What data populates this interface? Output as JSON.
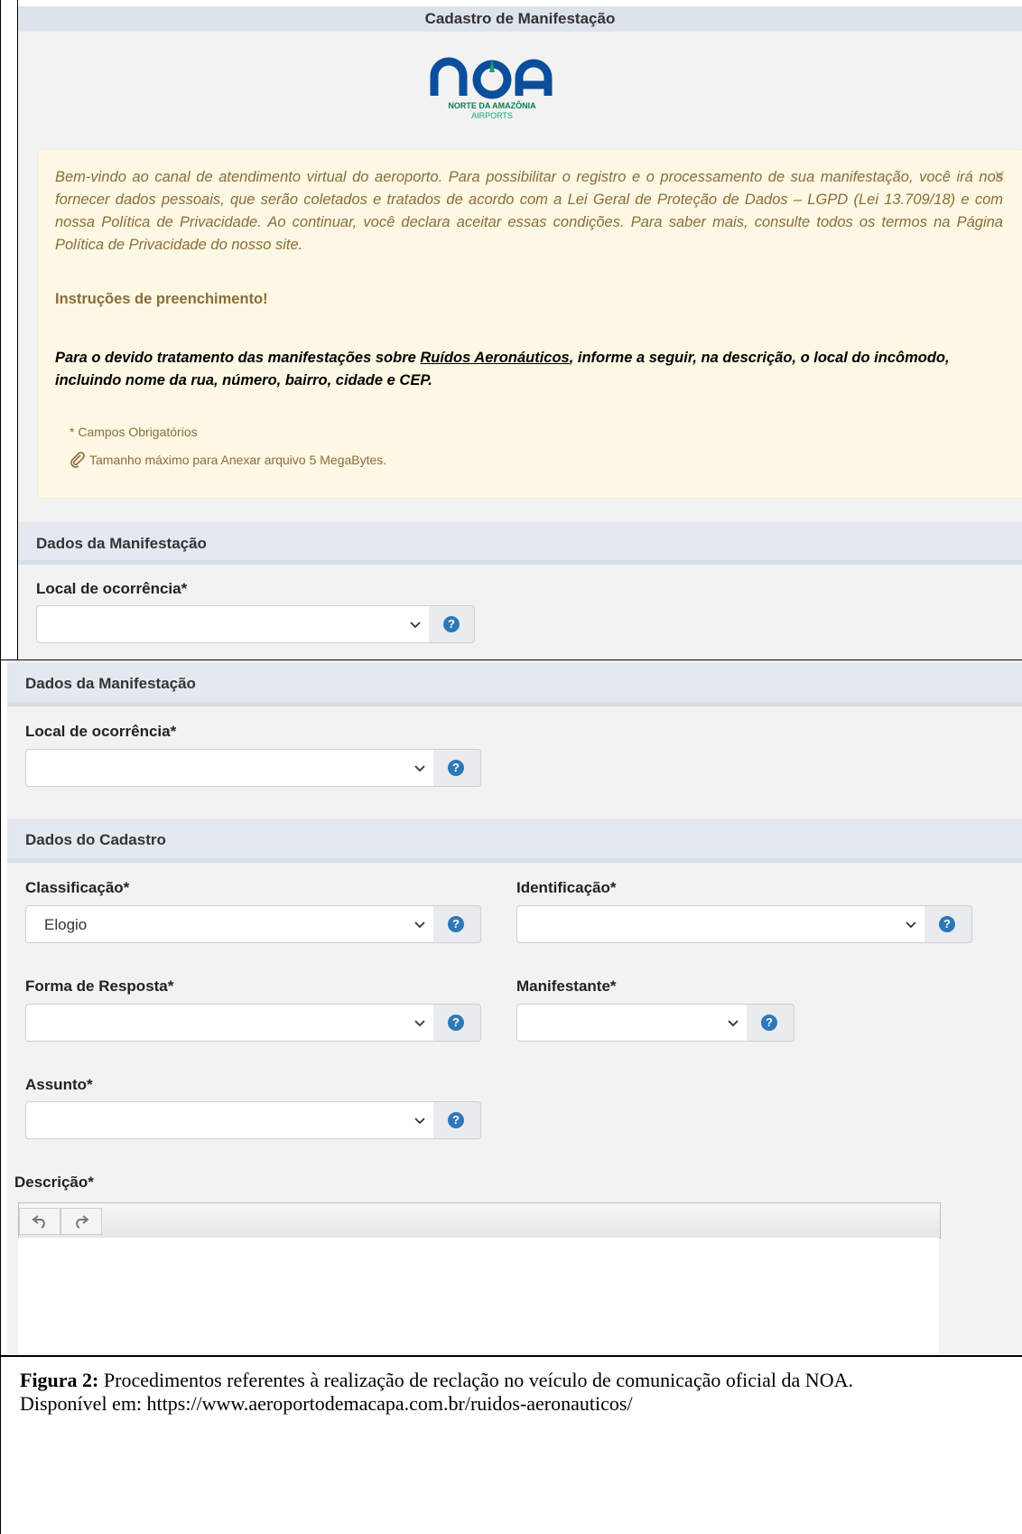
{
  "header": {
    "title": "Cadastro de Manifestação"
  },
  "logo": {
    "wordmark": "NOA",
    "line1": "NORTE DA AMAZÔNIA",
    "line2": "AIRPORTS"
  },
  "alert": {
    "intro": "Bem-vindo ao canal de atendimento virtual do aeroporto. Para possibilitar o registro e o processamento de sua manifestação, você irá nos fornecer dados pessoais, que serão coletados e tratados de acordo com a Lei Geral de Proteção de Dados – LGPD (Lei 13.709/18) e com nossa Política de Privacidade. Ao continuar, você declara aceitar essas condições. Para saber mais, consulte todos os termos na Página Política de Privacidade do nosso site.",
    "instructions_title": "Instruções de preenchimento!",
    "note_before": "Para o devido tratamento das manifestações sobre ",
    "note_link": "Ruídos Aeronáuticos",
    "note_after": ", informe a seguir, na descrição, o local do incômodo, incluindo nome da rua, número, bairro, cidade e CEP.",
    "required_note": "* Campos Obrigatórios",
    "size_note": "Tamanho máximo para Anexar arquivo 5 MegaBytes.",
    "close": "×"
  },
  "section_manifestacao": {
    "title": "Dados da Manifestação"
  },
  "local_ocorrencia": {
    "label": "Local de ocorrência*",
    "value": ""
  },
  "section_cadastro": {
    "title": "Dados do Cadastro"
  },
  "classificacao": {
    "label": "Classificação*",
    "value": "Elogio"
  },
  "identificacao": {
    "label": "Identificação*",
    "value": ""
  },
  "forma_resposta": {
    "label": "Forma de Resposta*",
    "value": ""
  },
  "manifestante": {
    "label": "Manifestante*",
    "value": ""
  },
  "assunto": {
    "label": "Assunto*",
    "value": ""
  },
  "descricao": {
    "label": "Descrição*"
  },
  "help_glyph": "?",
  "caption": {
    "figure": "Figura 2:",
    "text": " Procedimentos referentes à realização de reclação no veículo de comunicação oficial da NOA.",
    "source": "Disponível em: https://www.aeroportodemacapa.com.br/ruidos-aeronauticos/"
  },
  "colors": {
    "brand_blue": "#0b4f9c",
    "brand_green": "#0a7a55",
    "help_blue": "#2f78b7",
    "alert_bg": "#fcf8e3"
  }
}
